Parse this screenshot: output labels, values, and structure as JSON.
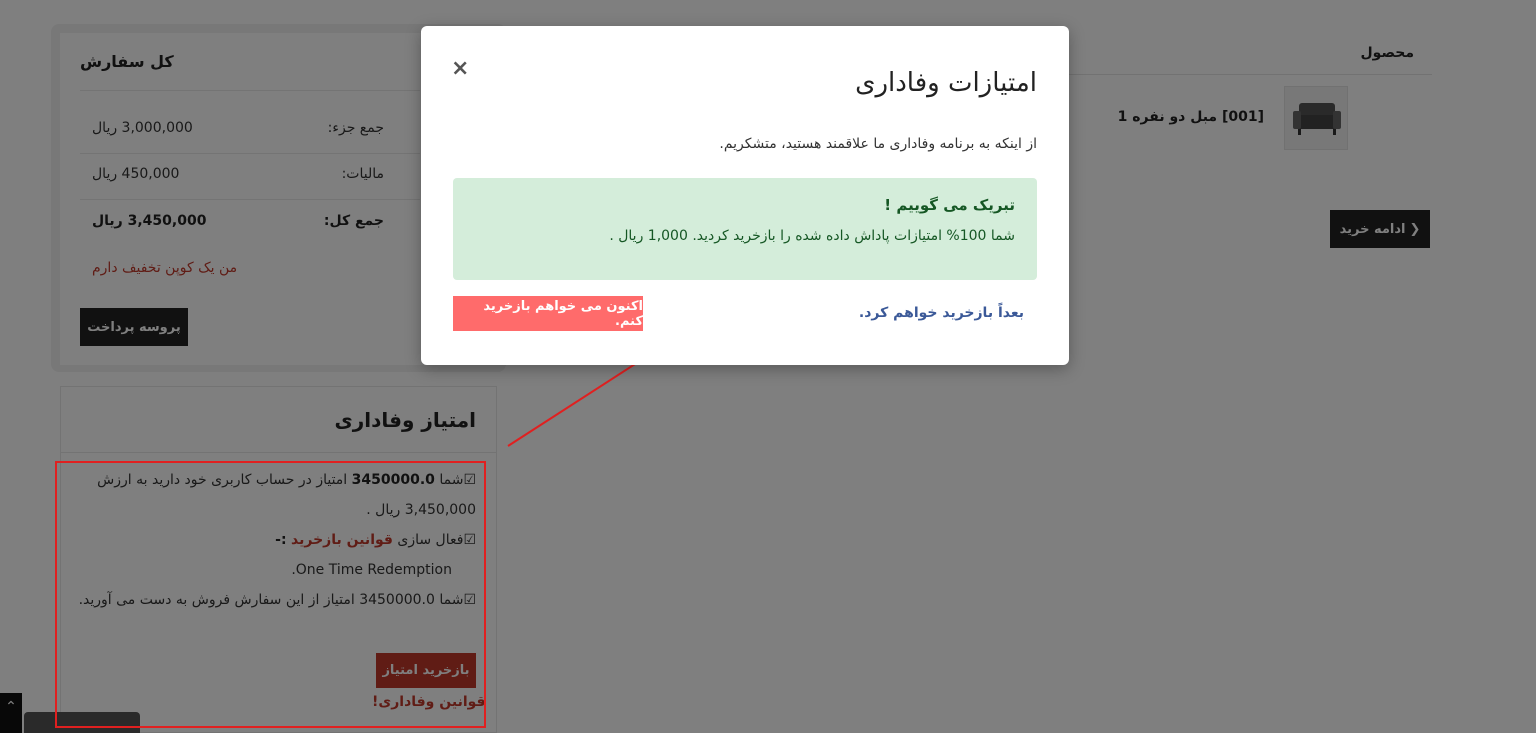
{
  "product_table": {
    "column_product": "محصول",
    "item_name": "[001] مبل دو نفره 1",
    "continue_label": "ادامه خرید",
    "continue_icon": "chevron-left-icon"
  },
  "summary": {
    "title": "کل سفارش",
    "rows": [
      {
        "label": "جمع جزء:",
        "value": "3,000,000 ریال"
      },
      {
        "label": "مالیات:",
        "value": "450,000 ریال"
      },
      {
        "label": "جمع کل:",
        "value": "3,450,000 ریال"
      }
    ],
    "coupon_link": "من یک کوپن تخفیف دارم",
    "checkout_label": "پروسه پرداخت"
  },
  "loyalty": {
    "title": "امتیاز وفاداری",
    "line1_prefix": "☑شما",
    "line1_points": "3450000.0",
    "line1_suffix": "امتیاز در حساب کاربری خود دارید به ارزش 3,450,000 ریال .",
    "line2_prefix": "☑فعال سازی",
    "line2_link": "قوانین بازخرید",
    "line2_suffix": ":-",
    "line3": "One Time Redemption.",
    "line4": "☑شما 3450000.0 امتیاز از این سفارش فروش به دست می آورید.",
    "redeem_label": "بازخرید امتیاز",
    "rules_link": "قوانین وفاداری!"
  },
  "modal": {
    "close_icon": "×",
    "title": "امتیازات وفاداری",
    "body": "از اینکه به برنامه وفاداری ما علاقمند هستید، متشکریم.",
    "alert_heading": "تبریک می گوییم !",
    "alert_text": "شما 100% امتیازات پاداش داده شده را بازخرید کردید. 1,000 ریال .",
    "later_label": "بعداً بازخرید خواهم کرد.",
    "redeem_now_label": "اکنون می خواهم بازخرید کنم."
  },
  "colors": {
    "overlay": "#000000",
    "accent_red": "#c0392b",
    "alert_bg": "#d4edda",
    "redeem_now_bg": "#ff6b6b",
    "annotation": "#e02020"
  }
}
